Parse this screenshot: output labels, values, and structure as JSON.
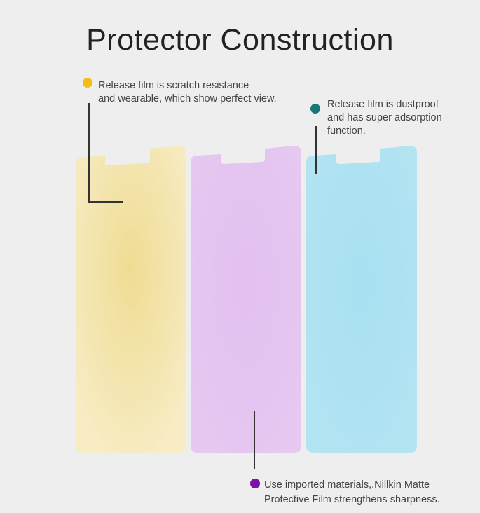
{
  "title": "Protector Construction",
  "colors": {
    "background": "#eeeeee",
    "film_matte": "#f5e7b3",
    "film_core": "#e5c3f0",
    "film_release": "#ade3f2",
    "dot_yellow": "#f8bb14",
    "dot_teal": "#17787c",
    "dot_purple": "#7c11a5"
  },
  "callouts": {
    "left": {
      "icon": "yellow-dot-icon",
      "line1": "Release film is scratch resistance",
      "line2": "and wearable, which show perfect view."
    },
    "right": {
      "icon": "teal-dot-icon",
      "line1": "Release film is dustproof",
      "line2": "and has super adsorption",
      "line3": "function."
    },
    "bottom": {
      "icon": "purple-dot-icon",
      "line1": "Use imported materials,.Nillkin Matte",
      "line2": "Protective Film strengthens sharpness."
    }
  }
}
